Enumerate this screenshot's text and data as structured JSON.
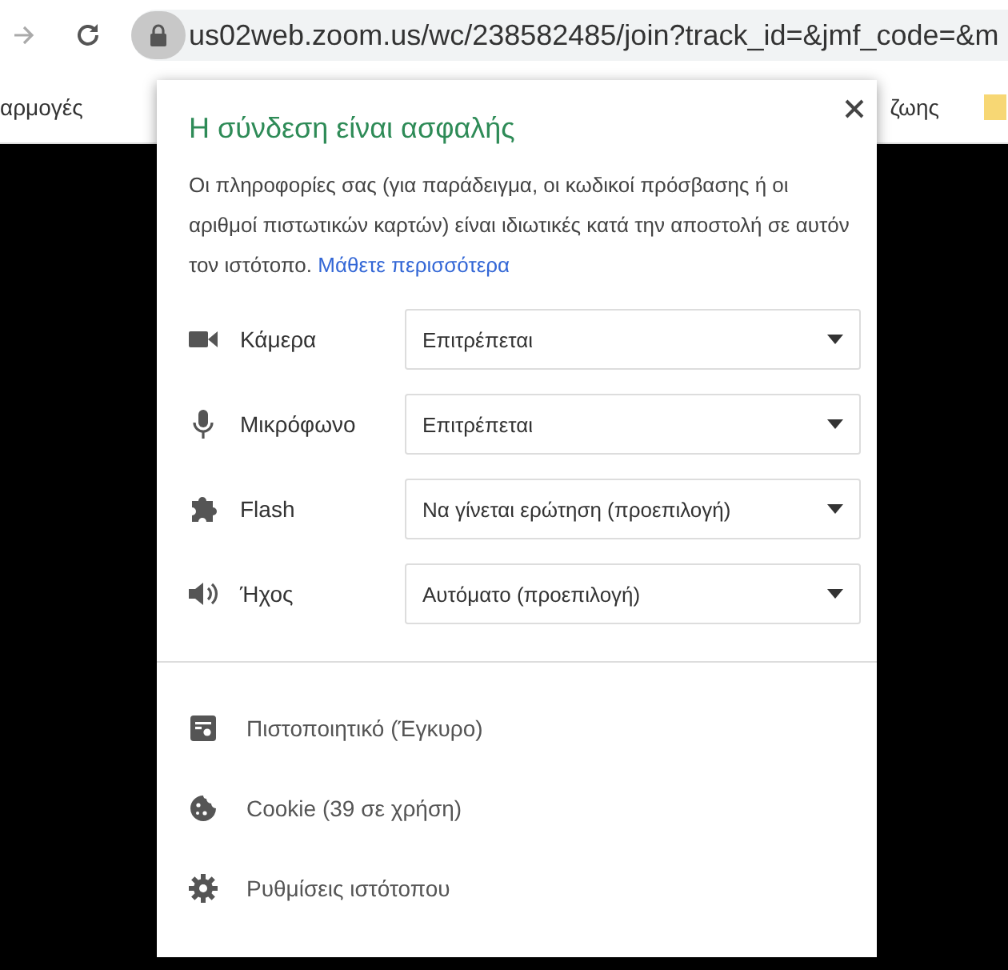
{
  "toolbar": {
    "url": "us02web.zoom.us/wc/238582485/join?track_id=&jmf_code=&m"
  },
  "bookmarks": [
    {
      "label": "αρμογές"
    },
    {
      "label": "ζωης"
    }
  ],
  "popup": {
    "title": "Η σύνδεση είναι ασφαλής",
    "description": "Οι πληροφορίες σας (για παράδειγμα, οι κωδικοί πρόσβασης ή οι αριθμοί πιστωτικών καρτών) είναι ιδιωτικές κατά την αποστολή σε αυτόν τον ιστότοπο.",
    "link": "Μάθετε περισσότερα",
    "permissions": [
      {
        "kind": "camera",
        "label": "Κάμερα",
        "value": "Επιτρέπεται"
      },
      {
        "kind": "microphone",
        "label": "Μικρόφωνο",
        "value": "Επιτρέπεται"
      },
      {
        "kind": "plugin",
        "label": "Flash",
        "value": "Να γίνεται ερώτηση (προεπιλογή)"
      },
      {
        "kind": "sound",
        "label": "Ήχος",
        "value": "Αυτόματο (προεπιλογή)"
      }
    ],
    "links": [
      {
        "kind": "certificate",
        "label": "Πιστοποιητικό (Έγκυρο)"
      },
      {
        "kind": "cookie",
        "label": "Cookie (39 σε χρήση)"
      },
      {
        "kind": "settings",
        "label": "Ρυθμίσεις ιστότοπου"
      }
    ]
  }
}
